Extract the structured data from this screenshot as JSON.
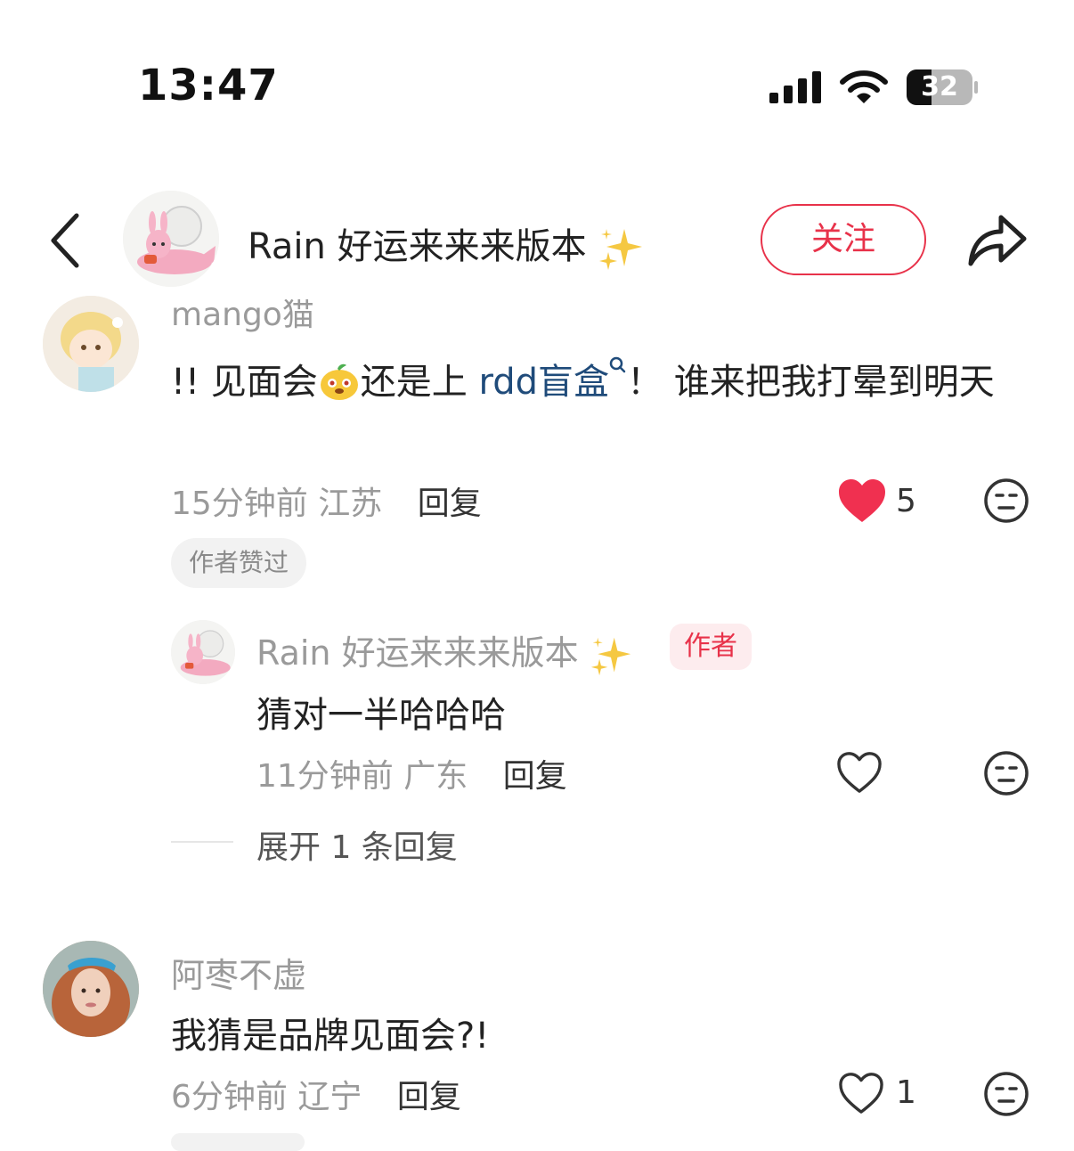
{
  "status_bar": {
    "time": "13:47",
    "battery": "32"
  },
  "header": {
    "title": "Rain 好运来来来版本",
    "follow_label": "关注"
  },
  "comments": [
    {
      "username": "mango猫",
      "text_before_emoji": "!! 见面会",
      "text_after_emoji": "还是上 ",
      "link_text": "rdd盲盒",
      "text_end": "！ 谁来把我打晕到明天",
      "time": "15分钟前",
      "location": "江苏",
      "reply_label": "回复",
      "likes": "5",
      "liked": true,
      "author_liked_label": "作者赞过",
      "replies": [
        {
          "username": "Rain 好运来来来版本",
          "author_tag": "作者",
          "text": "猜对一半哈哈哈",
          "time": "11分钟前",
          "location": "广东",
          "reply_label": "回复"
        }
      ],
      "expand_label": "展开 1 条回复"
    },
    {
      "username": "阿枣不虚",
      "text": "我猜是品牌见面会?!",
      "time": "6分钟前",
      "location": "辽宁",
      "reply_label": "回复",
      "likes": "1",
      "liked": false
    }
  ],
  "colors": {
    "accent": "#e8324a",
    "link": "#1f4b7a",
    "muted": "#9a9a9a"
  },
  "icons": [
    "signal-icon",
    "wifi-icon",
    "battery-icon",
    "back-chevron-icon",
    "share-icon",
    "sparkle-icon",
    "heart-icon",
    "neutral-face-icon",
    "search-icon",
    "mascot-emoji-icon"
  ]
}
